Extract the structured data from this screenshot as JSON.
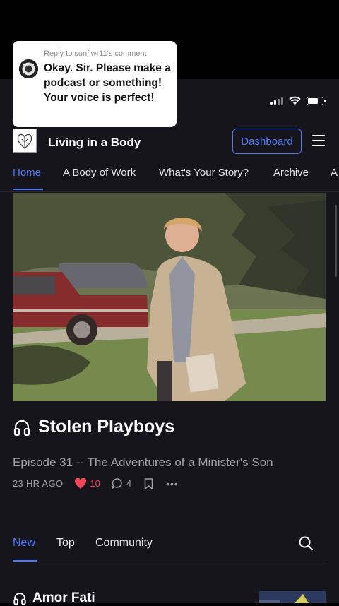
{
  "comment": {
    "reply_to": "Reply to sunflwr11's comment",
    "text": "Okay. Sir. Please make a podcast or something! Your voice is perfect!"
  },
  "header": {
    "publication_title": "Living in a Body",
    "dashboard_label": "Dashboard"
  },
  "nav": {
    "items": [
      {
        "label": "Home"
      },
      {
        "label": "A Body of Work"
      },
      {
        "label": "What's Your Story?"
      },
      {
        "label": "Archive"
      },
      {
        "label": "A"
      }
    ]
  },
  "post": {
    "title": "Stolen Playboys",
    "subtitle": "Episode 31 -- The Adventures of a Minister's Son",
    "date": "23 HR AGO",
    "likes": "10",
    "comments": "4",
    "more": "•••"
  },
  "tabs": {
    "items": [
      {
        "label": "New"
      },
      {
        "label": "Top"
      },
      {
        "label": "Community"
      }
    ]
  },
  "next_post": {
    "title": "Amor Fati"
  },
  "colors": {
    "accent": "#4a78ff",
    "like": "#f0465a",
    "background": "#16151c"
  }
}
